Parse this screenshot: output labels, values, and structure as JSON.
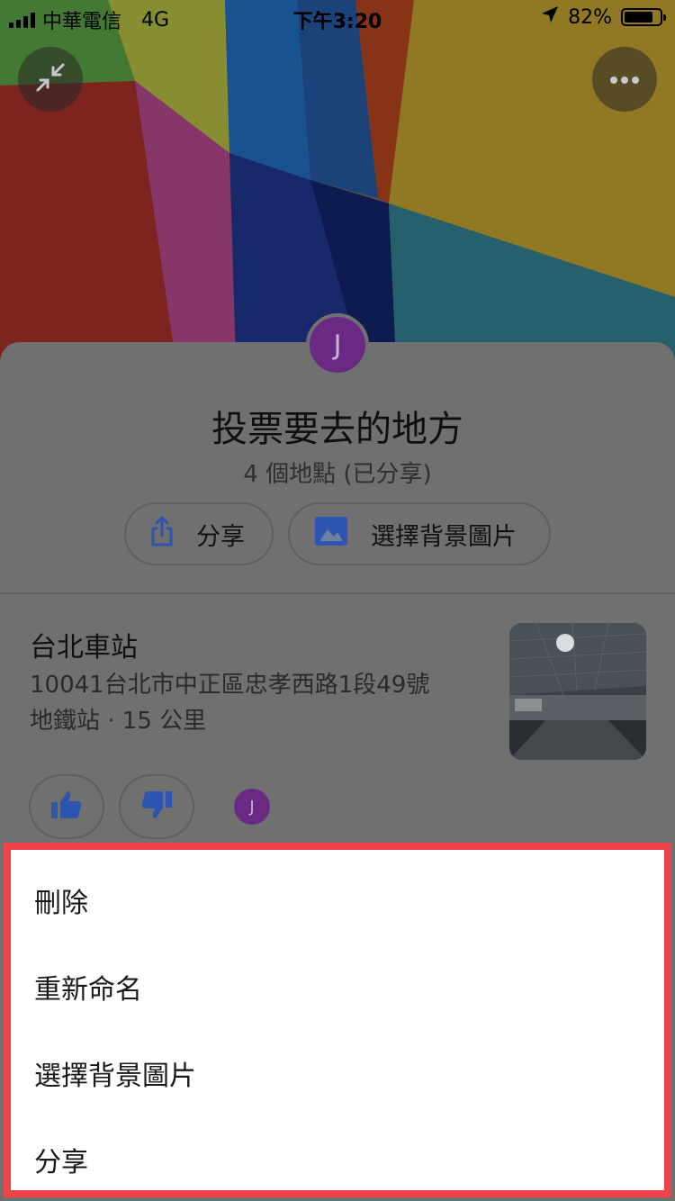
{
  "status_bar": {
    "carrier": "中華電信",
    "network": "4G",
    "time": "下午3:20",
    "battery_percent": "82%",
    "battery_level": 0.82
  },
  "header": {
    "collapse_icon": "collapse-arrows-icon",
    "more_icon": "more-horizontal-icon"
  },
  "list": {
    "avatar_initial": "J",
    "title": "投票要去的地方",
    "subtitle": "4 個地點 (已分享)",
    "share_label": "分享",
    "background_label": "選擇背景圖片"
  },
  "place": {
    "name": "台北車站",
    "address": "10041台北市中正區忠孝西路1段49號",
    "meta": "地鐵站 · 15 公里",
    "voter_initial": "J"
  },
  "menu": {
    "items": [
      "刪除",
      "重新命名",
      "選擇背景圖片",
      "分享"
    ]
  },
  "colors": {
    "avatar": "#6a2a84",
    "accent_blue": "#2b55b0",
    "highlight_border": "#f0434a"
  }
}
